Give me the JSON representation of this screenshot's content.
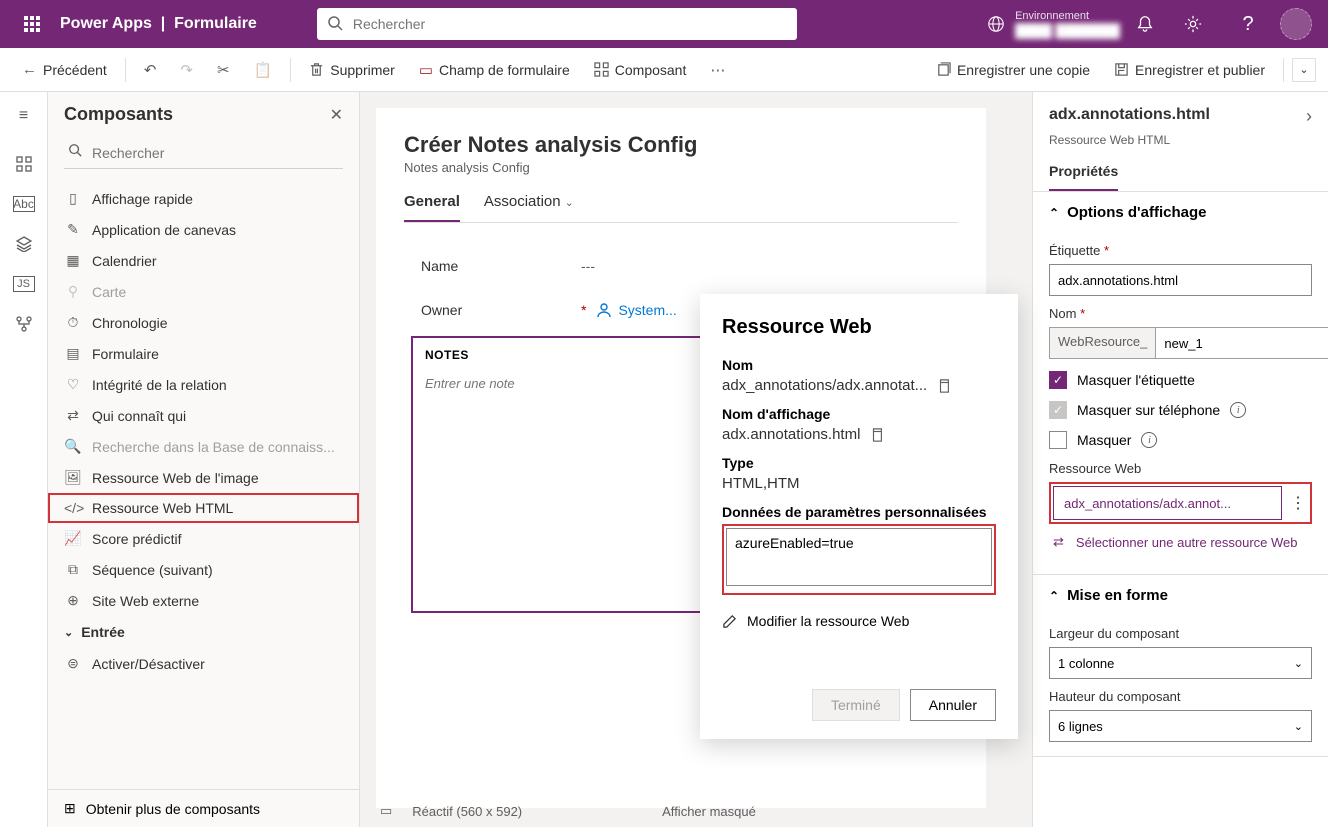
{
  "topbar": {
    "app": "Power Apps",
    "page": "Formulaire",
    "search_placeholder": "Rechercher",
    "env_label": "Environnement",
    "env_name": "████ ███████"
  },
  "cmdbar": {
    "back": "Précédent",
    "delete": "Supprimer",
    "form_field": "Champ de formulaire",
    "component": "Composant",
    "save_copy": "Enregistrer une copie",
    "save_publish": "Enregistrer et publier"
  },
  "components": {
    "title": "Composants",
    "search_placeholder": "Rechercher",
    "items": [
      {
        "icon": "view-icon",
        "label": "Affichage rapide"
      },
      {
        "icon": "canvas-app-icon",
        "label": "Application de canevas"
      },
      {
        "icon": "calendar-icon",
        "label": "Calendrier"
      },
      {
        "icon": "map-icon",
        "label": "Carte",
        "disabled": true
      },
      {
        "icon": "timeline-icon",
        "label": "Chronologie"
      },
      {
        "icon": "form-icon",
        "label": "Formulaire"
      },
      {
        "icon": "relation-icon",
        "label": "Intégrité de la relation"
      },
      {
        "icon": "who-knows-icon",
        "label": "Qui connaît qui"
      },
      {
        "icon": "kb-search-icon",
        "label": "Recherche dans la Base de connaiss...",
        "disabled": true
      },
      {
        "icon": "image-res-icon",
        "label": "Ressource Web de l'image"
      },
      {
        "icon": "html-res-icon",
        "label": "Ressource Web HTML",
        "highlighted": true
      },
      {
        "icon": "predictive-icon",
        "label": "Score prédictif"
      },
      {
        "icon": "sequence-icon",
        "label": "Séquence (suivant)"
      },
      {
        "icon": "external-site-icon",
        "label": "Site Web externe"
      }
    ],
    "group": "Entrée",
    "group_items": [
      {
        "icon": "toggle-icon",
        "label": "Activer/Désactiver"
      }
    ],
    "footer": "Obtenir plus de composants"
  },
  "form": {
    "title": "Créer Notes analysis Config",
    "subtitle": "Notes analysis Config",
    "tabs": [
      "General",
      "Association"
    ],
    "fields": {
      "name_label": "Name",
      "name_value": "---",
      "owner_label": "Owner",
      "owner_value": "System..."
    },
    "notes_header": "NOTES",
    "notes_placeholder": "Entrer une note",
    "footer_mode": "Réactif (560 x 592)",
    "footer_hidden": "Afficher masqué"
  },
  "popup": {
    "title": "Ressource Web",
    "name_label": "Nom",
    "name_value": "adx_annotations/adx.annotat...",
    "display_label": "Nom d'affichage",
    "display_value": "adx.annotations.html",
    "type_label": "Type",
    "type_value": "HTML,HTM",
    "params_label": "Données de paramètres personnalisées",
    "params_value": "azureEnabled=true",
    "edit": "Modifier la ressource Web",
    "done": "Terminé",
    "cancel": "Annuler"
  },
  "props": {
    "title": "adx.annotations.html",
    "subtitle": "Ressource Web HTML",
    "tab": "Propriétés",
    "section_display": "Options d'affichage",
    "label_label": "Étiquette",
    "label_value": "adx.annotations.html",
    "name_label": "Nom",
    "name_prefix": "WebResource_",
    "name_value": "new_1",
    "hide_label": "Masquer l'étiquette",
    "hide_phone": "Masquer sur téléphone",
    "hide": "Masquer",
    "resource_label": "Ressource Web",
    "resource_value": "adx_annotations/adx.annot...",
    "resource_switch": "Sélectionner une autre ressource Web",
    "section_layout": "Mise en forme",
    "width_label": "Largeur du composant",
    "width_value": "1 colonne",
    "height_label": "Hauteur du composant",
    "height_value": "6 lignes"
  }
}
